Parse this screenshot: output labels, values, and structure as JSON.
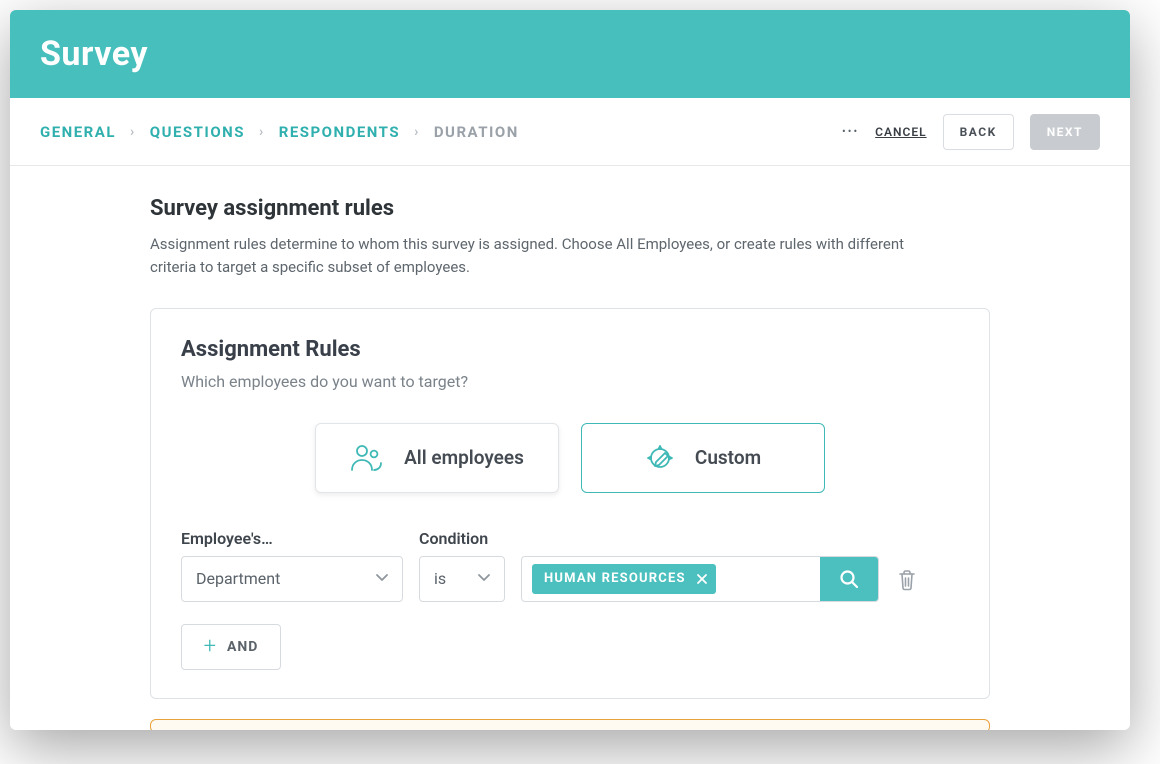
{
  "header": {
    "title": "Survey"
  },
  "breadcrumbs": {
    "items": [
      {
        "label": "GENERAL",
        "active": true
      },
      {
        "label": "QUESTIONS",
        "active": true
      },
      {
        "label": "RESPONDENTS",
        "active": true
      },
      {
        "label": "DURATION",
        "active": false
      }
    ]
  },
  "actions": {
    "more": "•••",
    "cancel": "CANCEL",
    "back": "BACK",
    "next": "NEXT"
  },
  "page": {
    "title": "Survey assignment rules",
    "description": "Assignment rules determine to whom this survey is assigned. Choose All Employees, or create rules with different criteria to target a specific subset of employees."
  },
  "card": {
    "title": "Assignment Rules",
    "subtitle": "Which employees do you want to target?",
    "options": {
      "all_label": "All employees",
      "custom_label": "Custom",
      "selected": "custom"
    },
    "rule": {
      "field_label": "Employee's…",
      "field_value": "Department",
      "condition_label": "Condition",
      "condition_value": "is",
      "chip_value": "HUMAN RESOURCES"
    },
    "and_label": "AND"
  },
  "icons": {
    "people": "people-icon",
    "custom": "custom-icon",
    "search": "search-icon",
    "trash": "trash-icon",
    "chevron": "chevron-down-icon",
    "close": "close-icon",
    "plus": "plus-icon"
  },
  "colors": {
    "accent": "#47bfbd",
    "chip": "#4cc0be",
    "alert_border": "#e9a13b"
  }
}
